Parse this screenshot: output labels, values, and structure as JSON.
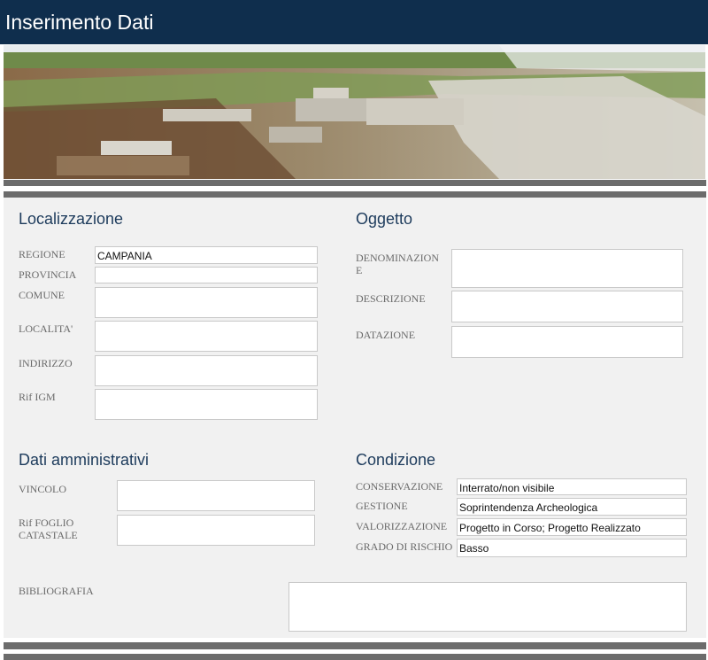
{
  "header": {
    "title": "Inserimento Dati"
  },
  "banner": {
    "image": "archaeological-site-photo"
  },
  "localizzazione": {
    "title": "Localizzazione",
    "regione": {
      "label": "REGIONE",
      "value": "CAMPANIA"
    },
    "provincia": {
      "label": "PROVINCIA",
      "value": ""
    },
    "comune": {
      "label": "COMUNE",
      "value": ""
    },
    "localita": {
      "label": "LOCALITA'",
      "value": ""
    },
    "indirizzo": {
      "label": "INDIRIZZO",
      "value": ""
    },
    "rif_igm": {
      "label": "Rif IGM",
      "value": ""
    }
  },
  "oggetto": {
    "title": "Oggetto",
    "denominazione": {
      "label_1": "DENOMINAZION",
      "label_2": "E",
      "value": ""
    },
    "descrizione": {
      "label": "DESCRIZIONE",
      "value": ""
    },
    "datazione": {
      "label": "DATAZIONE",
      "value": ""
    }
  },
  "amministrativi": {
    "title": "Dati amministrativi",
    "vincolo": {
      "label": "VINCOLO",
      "value": ""
    },
    "rif_foglio": {
      "label_1": "Rif FOGLIO",
      "label_2": "CATASTALE",
      "value": ""
    }
  },
  "condizione": {
    "title": "Condizione",
    "conservazione": {
      "label": "CONSERVAZIONE",
      "value": "Interrato/non visibile"
    },
    "gestione": {
      "label": "GESTIONE",
      "value": "Soprintendenza Archeologica"
    },
    "valorizzazione": {
      "label": "VALORIZZAZIONE",
      "value": "Progetto in Corso; Progetto Realizzato"
    },
    "grado_rischio": {
      "label": "GRADO DI RISCHIO",
      "value": "Basso"
    }
  },
  "bibliografia": {
    "label": "BIBLIOGRAFIA",
    "value": ""
  }
}
